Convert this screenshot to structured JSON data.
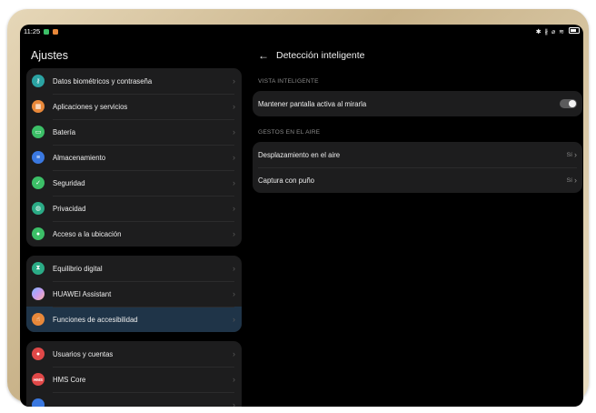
{
  "status": {
    "time": "11:25",
    "right_icons": "✱ ∦ ⌀ ≋"
  },
  "left": {
    "title": "Ajustes",
    "group1": [
      {
        "label": "Datos biométricos y contraseña",
        "icon": "key-icon",
        "color": "#2ba3a3",
        "glyph": "⚷"
      },
      {
        "label": "Aplicaciones y servicios",
        "icon": "apps-icon",
        "color": "#e8883a",
        "glyph": "▦"
      },
      {
        "label": "Batería",
        "icon": "battery-icon",
        "color": "#3cbf67",
        "glyph": "▭"
      },
      {
        "label": "Almacenamiento",
        "icon": "storage-icon",
        "color": "#3a78e0",
        "glyph": "≡"
      },
      {
        "label": "Seguridad",
        "icon": "shield-check-icon",
        "color": "#3cbf67",
        "glyph": "✓"
      },
      {
        "label": "Privacidad",
        "icon": "privacy-icon",
        "color": "#2bab86",
        "glyph": "◍"
      },
      {
        "label": "Acceso a la ubicación",
        "icon": "location-icon",
        "color": "#3cbf67",
        "glyph": "●"
      }
    ],
    "group2": [
      {
        "label": "Equilibrio digital",
        "icon": "hourglass-icon",
        "color": "#2bab86",
        "glyph": "⧗"
      },
      {
        "label": "HUAWEI Assistant",
        "icon": "assistant-icon",
        "color": "#9a7de6",
        "glyph": ""
      },
      {
        "label": "Funciones de accesibilidad",
        "icon": "hand-icon",
        "color": "#e8883a",
        "glyph": "☝"
      }
    ],
    "group3": [
      {
        "label": "Usuarios y cuentas",
        "icon": "user-icon",
        "color": "#e04848",
        "glyph": "●"
      },
      {
        "label": "HMS Core",
        "icon": "hms-icon",
        "color": "#e04848",
        "glyph": "HMS"
      },
      {
        "label": "",
        "icon": "partial-icon",
        "color": "#3a78e0",
        "glyph": ""
      }
    ]
  },
  "detail": {
    "title": "Detección inteligente",
    "section1": "VISTA INTELIGENTE",
    "toggle_label": "Mantener pantalla activa al mirarla",
    "toggle_on": false,
    "section2": "GESTOS EN EL AIRE",
    "rows": [
      {
        "label": "Desplazamiento en el aire",
        "value": "Sí"
      },
      {
        "label": "Captura con puño",
        "value": "Sí"
      }
    ]
  },
  "colors": {
    "selected": "#1f3448",
    "card": "#1d1d1e",
    "screen": "#000000"
  }
}
